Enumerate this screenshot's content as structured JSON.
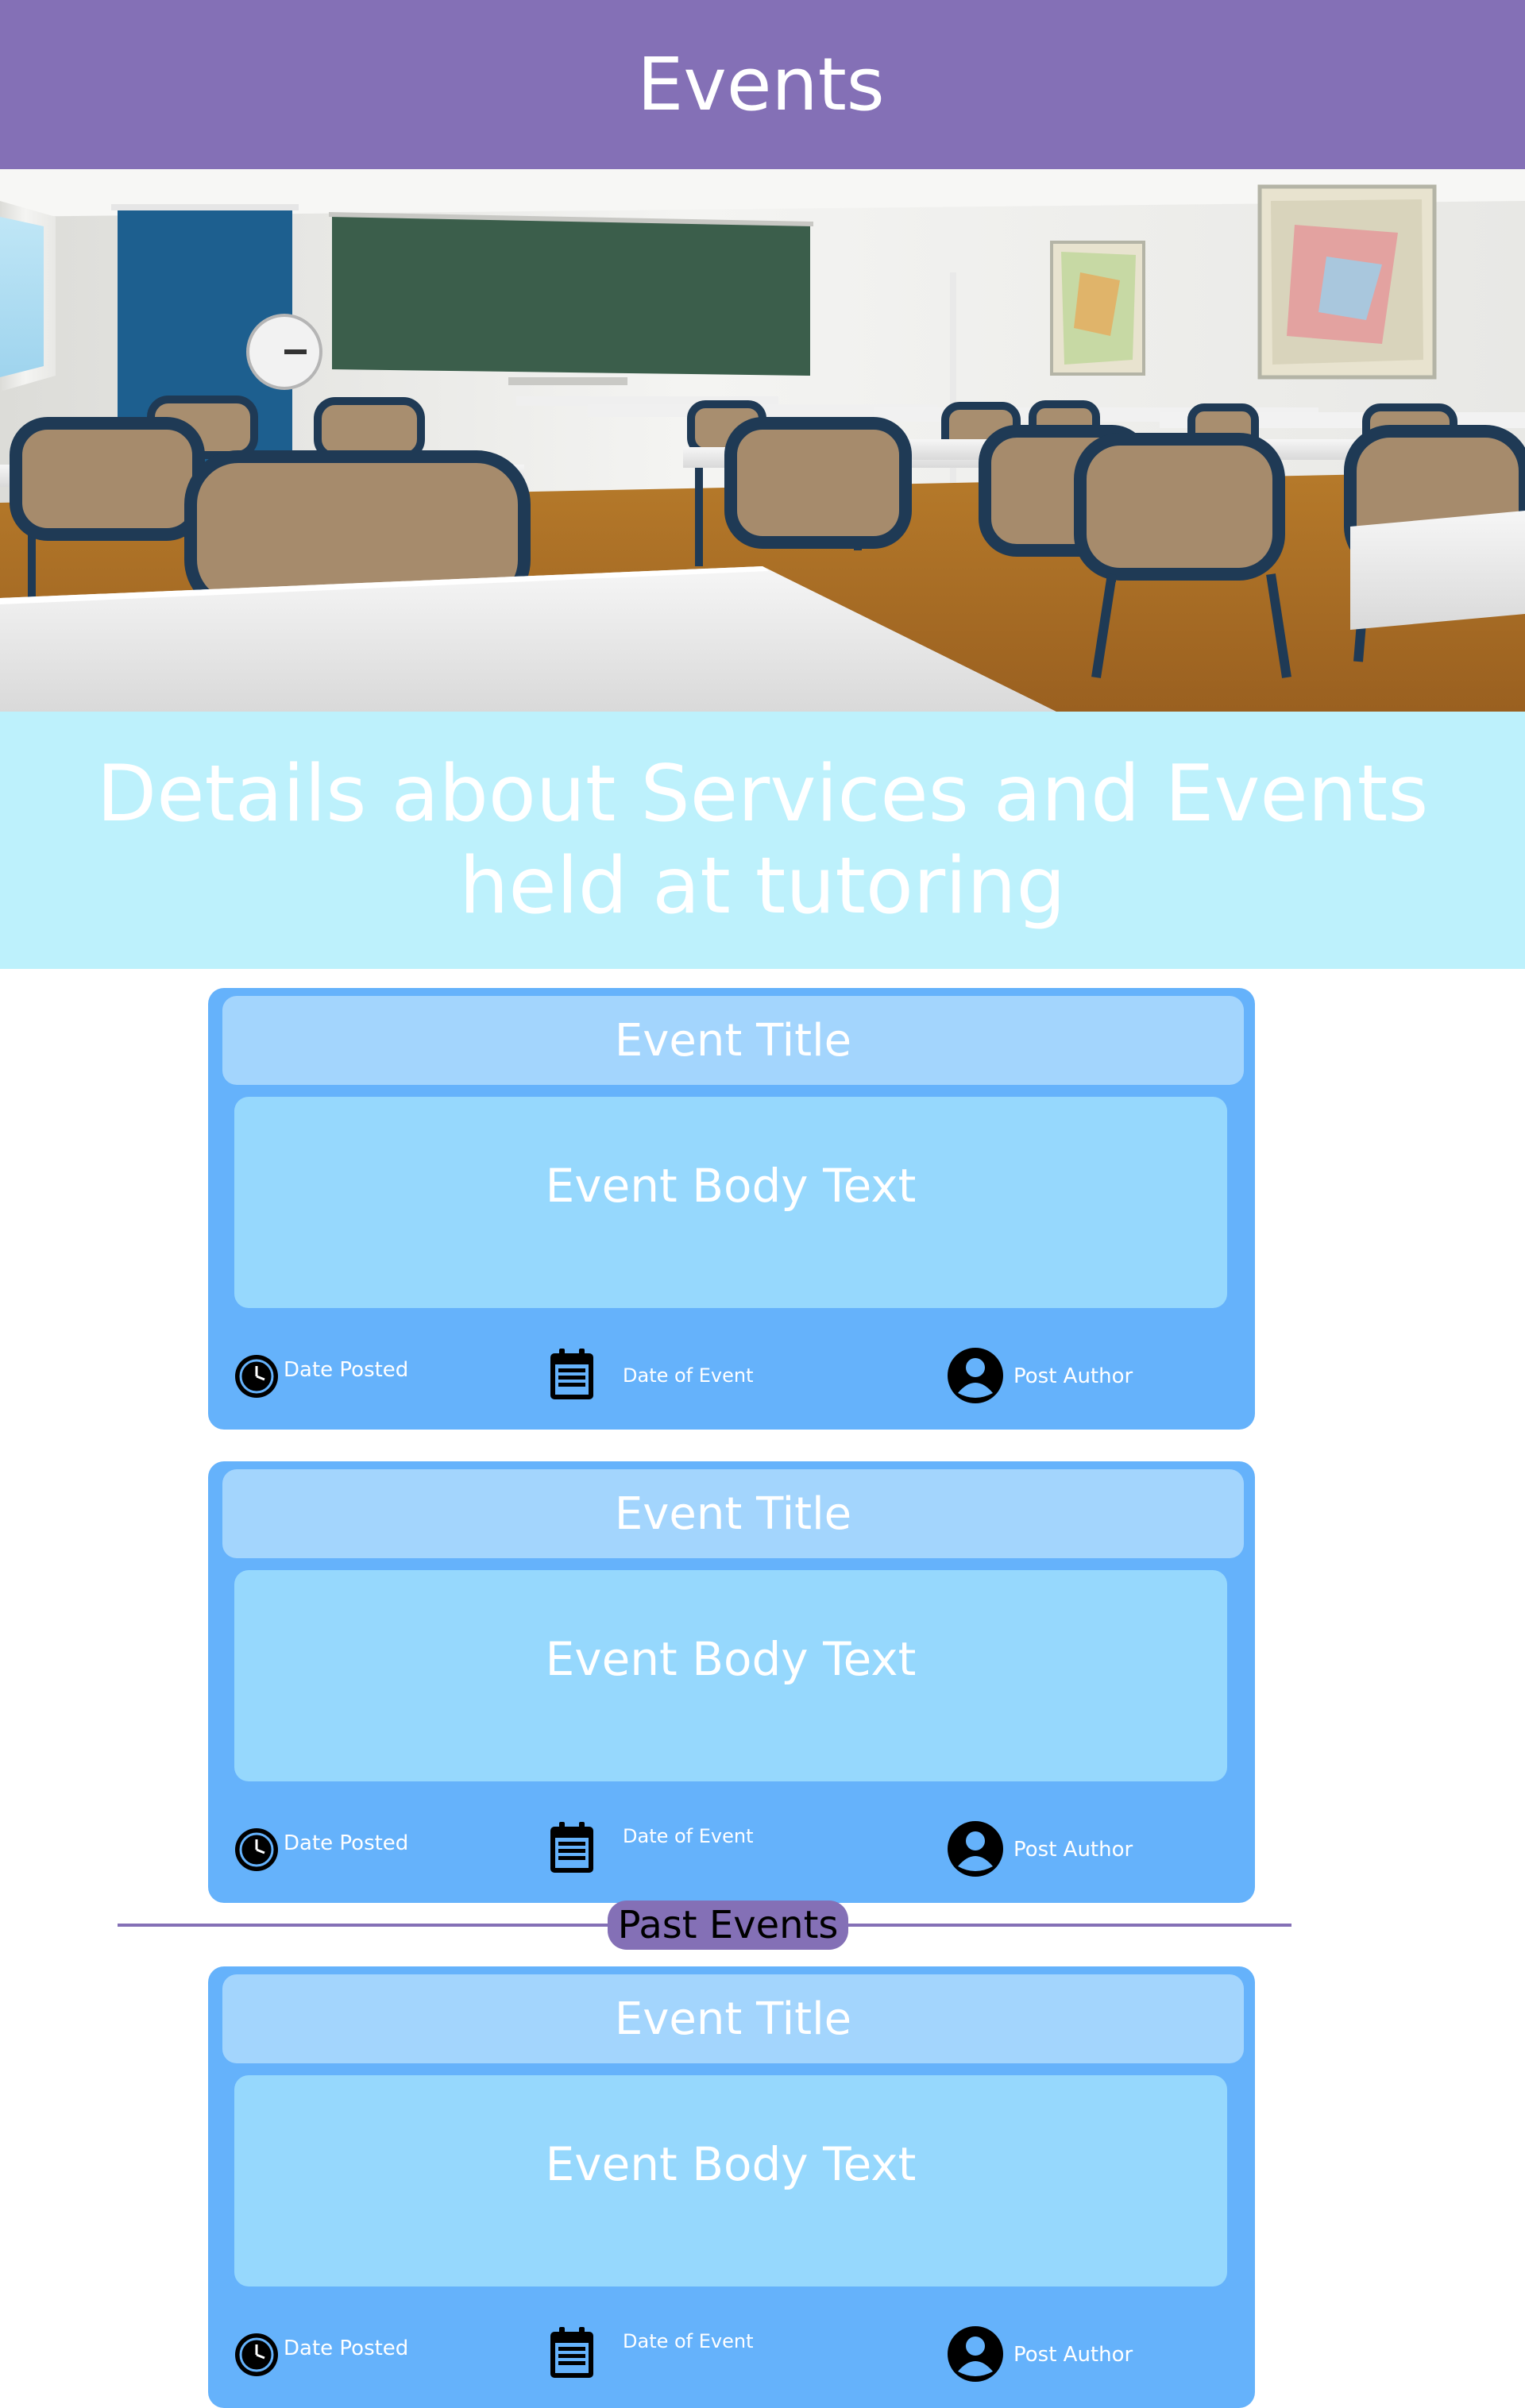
{
  "header": {
    "title": "Events"
  },
  "hero": {
    "alt": "classroom"
  },
  "banner": {
    "text": "Details about Services and Events held at tutoring"
  },
  "upcoming": [
    {
      "title": "Event Title",
      "body": "Event Body Text",
      "date_posted": "Date Posted",
      "date_of_event": "Date of Event",
      "author": "Post Author"
    },
    {
      "title": "Event Title",
      "body": "Event Body Text",
      "date_posted": "Date Posted",
      "date_of_event": "Date of Event",
      "author": "Post Author"
    }
  ],
  "past_events": {
    "label": "Past Events",
    "items": [
      {
        "title": "Event Title",
        "body": "Event Body Text",
        "date_posted": "Date Posted",
        "date_of_event": "Date of Event",
        "author": "Post Author"
      }
    ]
  },
  "icons": {
    "date_posted": "clock-icon",
    "date_of_event": "calendar-icon",
    "author": "user-avatar-icon"
  },
  "colors": {
    "header": "#8470b6",
    "banner": "#bdf1fc",
    "card": "#65b2fb",
    "card_title": "#a3d5fd",
    "card_body": "#96d8fd"
  }
}
